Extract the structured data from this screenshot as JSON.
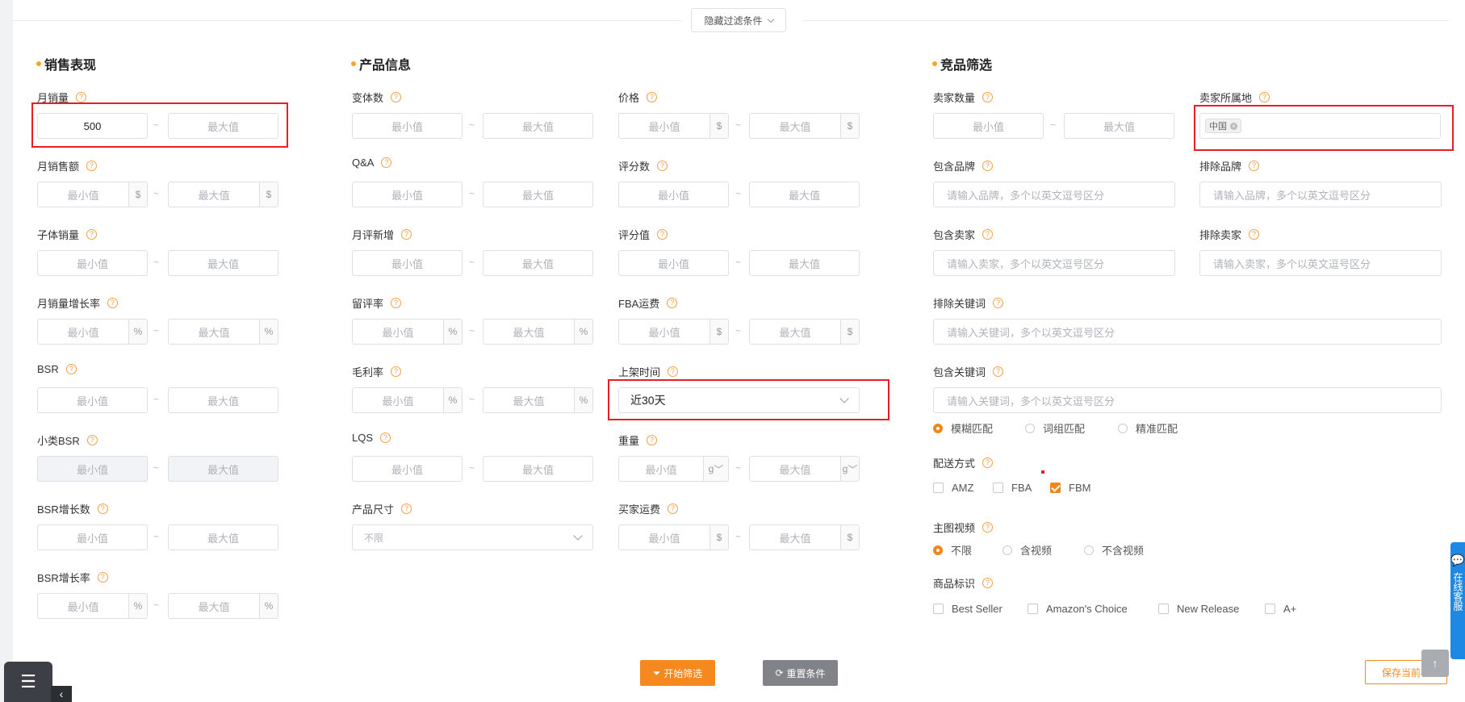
{
  "header": {
    "hide_filters_label": "隐藏过滤条件"
  },
  "placeholders": {
    "min": "最小值",
    "max": "最大值",
    "tilde": "~",
    "dollar": "$",
    "percent": "%",
    "gram": "g"
  },
  "sales": {
    "title": "销售表现",
    "monthly_sales_label": "月销量",
    "monthly_sales_min_value": "500",
    "monthly_revenue_label": "月销售额",
    "child_sales_label": "子体销量",
    "monthly_sales_growth_label": "月销量增长率",
    "bsr_label": "BSR",
    "sub_bsr_label": "小类BSR",
    "bsr_growth_label": "BSR增长数",
    "bsr_growth_rate_label": "BSR增长率"
  },
  "product": {
    "title": "产品信息",
    "variants_label": "变体数",
    "qa_label": "Q&A",
    "monthly_reviews_label": "月评新增",
    "review_rate_label": "留评率",
    "gross_margin_label": "毛利率",
    "lqs_label": "LQS",
    "size_label": "产品尺寸",
    "size_value": "不限",
    "price_label": "价格",
    "ratings_count_label": "评分数",
    "rating_value_label": "评分值",
    "fba_fee_label": "FBA运费",
    "listing_time_label": "上架时间",
    "listing_time_value": "近30天",
    "weight_label": "重量",
    "buyer_shipping_label": "买家运费"
  },
  "competition": {
    "title": "竞品筛选",
    "seller_count_label": "卖家数量",
    "seller_location_label": "卖家所属地",
    "seller_location_tag": "中国",
    "include_brand_label": "包含品牌",
    "include_brand_placeholder": "请输入品牌，多个以英文逗号区分",
    "exclude_brand_label": "排除品牌",
    "exclude_brand_placeholder": "请输入品牌，多个以英文逗号区分",
    "include_seller_label": "包含卖家",
    "include_seller_placeholder": "请输入卖家，多个以英文逗号区分",
    "exclude_seller_label": "排除卖家",
    "exclude_seller_placeholder": "请输入卖家，多个以英文逗号区分",
    "exclude_keyword_label": "排除关键词",
    "exclude_keyword_placeholder": "请输入关键词，多个以英文逗号区分",
    "include_keyword_label": "包含关键词",
    "include_keyword_placeholder": "请输入关键词，多个以英文逗号区分",
    "match_options": [
      "模糊匹配",
      "词组匹配",
      "精准匹配"
    ],
    "delivery_label": "配送方式",
    "delivery_options": [
      "AMZ",
      "FBA",
      "FBM"
    ],
    "video_label": "主图视频",
    "video_options": [
      "不限",
      "含视频",
      "不含视频"
    ],
    "badge_label": "商品标识",
    "badge_options": [
      "Best Seller",
      "Amazon's Choice",
      "New Release",
      "A+"
    ]
  },
  "footer": {
    "start_label": "开始筛选",
    "reset_label": "重置条件",
    "save_label": "保存当前标"
  },
  "chat_label": "在线客服",
  "colors": {
    "accent": "#f5891f",
    "highlight": "#e81e25",
    "chat": "#1e88e5"
  }
}
